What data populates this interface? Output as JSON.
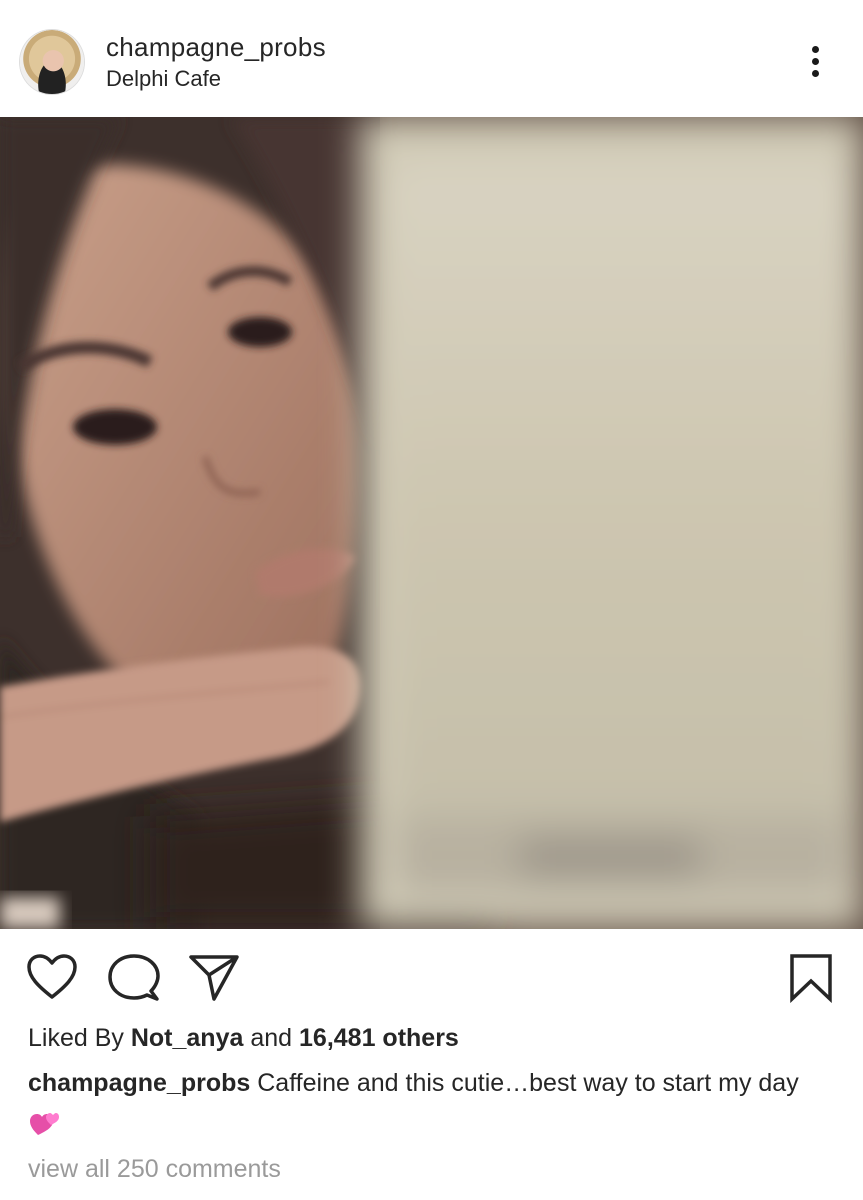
{
  "post": {
    "username": "champagne_probs",
    "location": "Delphi Cafe"
  },
  "likes": {
    "prefix": "Liked By",
    "liker": "Not_anya",
    "joiner": "and",
    "others": "16,481 others"
  },
  "caption": {
    "username": "champagne_probs",
    "text": "Caffeine and this cutie…best way to start my day",
    "emoji": "💞"
  },
  "comments": {
    "link": "view all 250 comments"
  },
  "icons": {
    "more": "more-options-icon",
    "like": "heart-icon",
    "comment": "comment-bubble-icon",
    "share": "paper-plane-icon",
    "save": "bookmark-icon"
  },
  "colors": {
    "text": "#262626",
    "muted": "#9a9a9a",
    "emoji_pink": "#e64fa8"
  }
}
